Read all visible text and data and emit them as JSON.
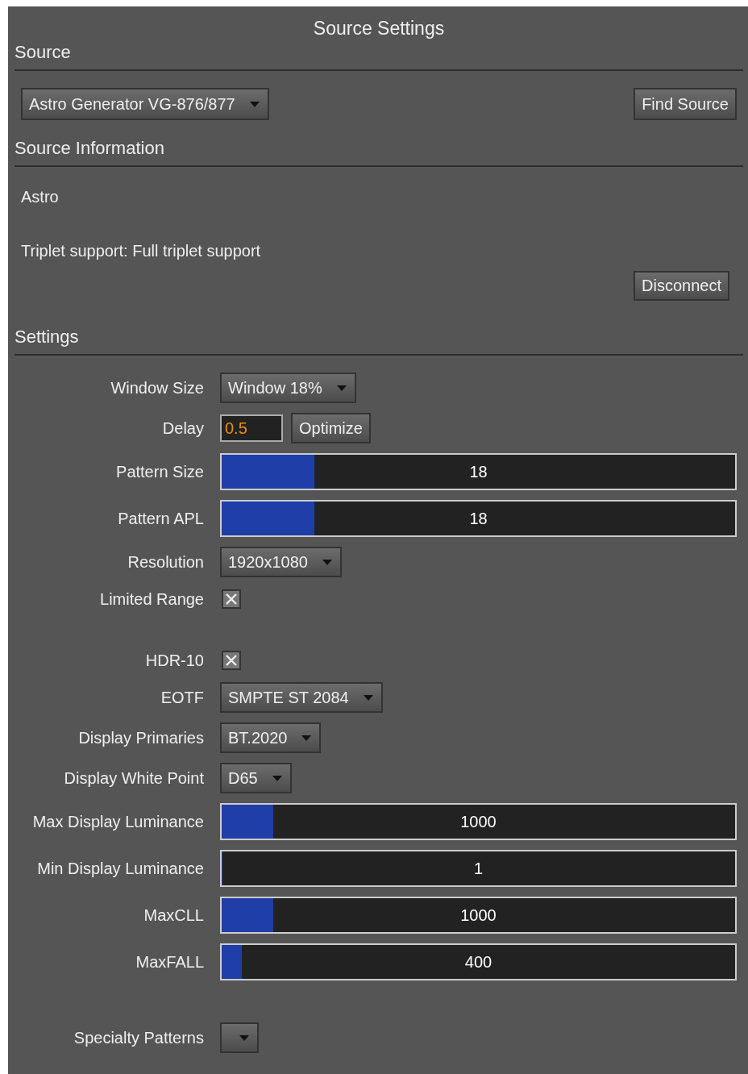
{
  "title": "Source Settings",
  "source": {
    "heading": "Source",
    "selector": {
      "value": "Astro Generator VG-876/877"
    },
    "find_button": "Find Source"
  },
  "source_information": {
    "heading": "Source Information",
    "name": "Astro",
    "triplet_support": "Triplet support: Full triplet support",
    "disconnect_button": "Disconnect"
  },
  "settings": {
    "heading": "Settings",
    "groups": [
      {
        "rows": [
          {
            "kind": "dropdown",
            "label": "Window Size",
            "value": "Window 18%"
          },
          {
            "kind": "input",
            "label": "Delay",
            "value": "0.5",
            "button": "Optimize"
          },
          {
            "kind": "slider",
            "label": "Pattern Size",
            "value": "18",
            "level": 0.18
          },
          {
            "kind": "slider",
            "label": "Pattern APL",
            "value": "18",
            "level": 0.18
          },
          {
            "kind": "dropdown",
            "label": "Resolution",
            "value": "1920x1080"
          },
          {
            "kind": "checkbox",
            "label": "Limited Range",
            "checked": true
          }
        ]
      },
      {
        "rows": [
          {
            "kind": "checkbox",
            "label": "HDR-10",
            "checked": true
          },
          {
            "kind": "dropdown",
            "label": "EOTF",
            "value": "SMPTE ST 2084"
          },
          {
            "kind": "dropdown",
            "label": "Display Primaries",
            "value": "BT.2020"
          },
          {
            "kind": "dropdown",
            "label": "Display White Point",
            "value": "D65"
          },
          {
            "kind": "slider",
            "label": "Max Display Luminance",
            "value": "1000",
            "level": 0.1
          },
          {
            "kind": "slider",
            "label": "Min Display Luminance",
            "value": "1",
            "level": 0
          },
          {
            "kind": "slider",
            "label": "MaxCLL",
            "value": "1000",
            "level": 0.1
          },
          {
            "kind": "slider",
            "label": "MaxFALL",
            "value": "400",
            "level": 0.04
          }
        ]
      },
      {
        "rows": [
          {
            "kind": "dropdown",
            "label": "Specialty Patterns"
          }
        ]
      }
    ]
  }
}
